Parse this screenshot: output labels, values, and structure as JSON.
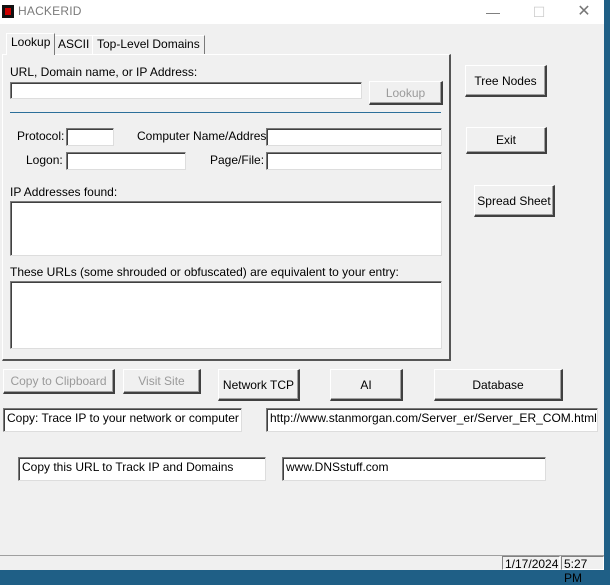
{
  "window": {
    "title": "HACKERID",
    "minimize": "—",
    "maximize": "☐",
    "close": "✕"
  },
  "tabs": [
    {
      "label": "Lookup"
    },
    {
      "label": "ASCII"
    },
    {
      "label": "Top-Level Domains"
    }
  ],
  "lookup": {
    "url_label": "URL, Domain name, or IP Address:",
    "url_value": "",
    "lookup_button": "Lookup",
    "protocol_label": "Protocol:",
    "protocol_value": "",
    "computer_label": "Computer Name/Address:",
    "computer_value": "",
    "logon_label": "Logon:",
    "logon_value": "",
    "pagefile_label": "Page/File:",
    "pagefile_value": "",
    "ip_found_label": "IP Addresses found:",
    "ip_found_value": "",
    "equivalent_label": "These URLs (some shrouded or obfuscated) are equivalent to your entry:",
    "equivalent_value": ""
  },
  "side_buttons": {
    "tree_nodes": "Tree Nodes",
    "exit": "Exit",
    "spread_sheet": "Spread Sheet"
  },
  "bottom_buttons": {
    "copy_clipboard": "Copy to Clipboard",
    "visit_site": "Visit Site",
    "network_tcp": "Network TCP",
    "ai": "AI",
    "database": "Database"
  },
  "info": {
    "copy_trace": "Copy: Trace IP to your network or computer",
    "stanmorgan_url": "http://www.stanmorgan.com/Server_er/Server_ER_COM.html",
    "copy_track": "Copy this URL to Track  IP and Domains",
    "dnsstuff_url": "www.DNSstuff.com"
  },
  "status": {
    "date": "1/17/2024",
    "time": "5:27 PM"
  },
  "colors": {
    "accent_line": "#2b6f9a",
    "desktop": "#1f5f86"
  }
}
